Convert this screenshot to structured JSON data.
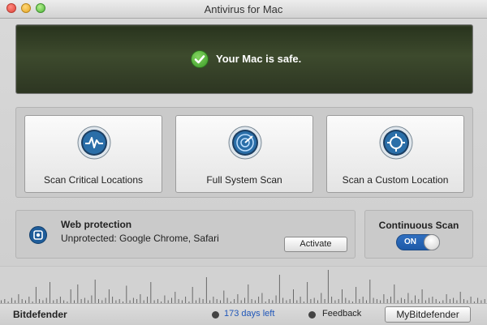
{
  "window": {
    "title": "Antivirus for Mac"
  },
  "status": {
    "text": "Your Mac is safe.",
    "color": "#3a9a27"
  },
  "scan_buttons": [
    {
      "label": "Scan Critical Locations",
      "icon": "pulse-icon"
    },
    {
      "label": "Full System Scan",
      "icon": "radar-icon"
    },
    {
      "label": "Scan a Custom Location",
      "icon": "target-icon"
    }
  ],
  "web_protection": {
    "title": "Web protection",
    "status": "Unprotected: Google Chrome, Safari",
    "button": "Activate"
  },
  "continuous_scan": {
    "title": "Continuous Scan",
    "toggle_label": "ON",
    "on": true
  },
  "activity_bars": [
    3,
    4,
    2,
    5,
    3,
    8,
    4,
    3,
    6,
    2,
    14,
    4,
    3,
    5,
    18,
    3,
    4,
    6,
    3,
    2,
    12,
    3,
    16,
    4,
    5,
    3,
    7,
    20,
    4,
    3,
    5,
    12,
    6,
    3,
    4,
    2,
    15,
    3,
    5,
    4,
    8,
    3,
    6,
    18,
    3,
    4,
    2,
    7,
    3,
    5,
    10,
    4,
    3,
    6,
    2,
    14,
    3,
    5,
    4,
    22,
    3,
    6,
    4,
    3,
    11,
    5,
    2,
    4,
    8,
    3,
    5,
    16,
    4,
    3,
    6,
    9,
    2,
    4,
    3,
    7,
    24,
    5,
    3,
    4,
    12,
    3,
    6,
    2,
    18,
    4,
    5,
    3,
    9,
    4,
    28,
    6,
    3,
    4,
    12,
    5,
    3,
    2,
    14,
    4,
    6,
    3,
    20,
    5,
    4,
    3,
    8,
    4,
    6,
    16,
    3,
    5,
    4,
    9,
    3,
    7,
    4,
    12,
    3,
    5,
    6,
    4,
    2,
    3,
    8,
    4,
    5,
    3,
    10,
    4,
    3,
    6,
    2,
    5,
    3,
    4
  ],
  "footer": {
    "brand": "Bitdefender",
    "days_left": "173 days left",
    "feedback": "Feedback",
    "account_button": "MyBitdefender"
  },
  "colors": {
    "accent": "#1e5aa8",
    "days_link": "#1f56b8",
    "banner": "#2d3622"
  }
}
